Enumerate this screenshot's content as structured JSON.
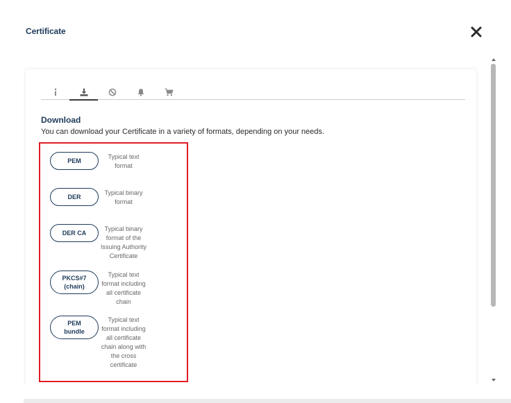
{
  "dialog": {
    "title": "Certificate",
    "close_icon": "close-icon"
  },
  "tabs": [
    {
      "icon": "info-icon",
      "active": false
    },
    {
      "icon": "download-icon",
      "active": true
    },
    {
      "icon": "revoke-icon",
      "active": false
    },
    {
      "icon": "bell-icon",
      "active": false
    },
    {
      "icon": "cart-icon",
      "active": false
    }
  ],
  "download": {
    "heading": "Download",
    "description": "You can download your Certificate in a variety of formats, depending on your needs.",
    "formats": [
      {
        "label_lines": [
          "PEM"
        ],
        "desc_lines": [
          "Typical text",
          "format"
        ]
      },
      {
        "label_lines": [
          "DER"
        ],
        "desc_lines": [
          "Typical binary",
          "format"
        ]
      },
      {
        "label_lines": [
          "DER CA"
        ],
        "desc_lines": [
          "Typical binary",
          "format of the",
          "Issuing Authority",
          "Certificate"
        ]
      },
      {
        "label_lines": [
          "PKCS#7",
          "(chain)"
        ],
        "desc_lines": [
          "Typical text",
          "format including",
          "all certificate",
          "chain"
        ]
      },
      {
        "label_lines": [
          "PEM",
          "bundle"
        ],
        "desc_lines": [
          "Typical text",
          "format including",
          "all certificate",
          "chain along with",
          "the cross",
          "certificate"
        ]
      }
    ]
  },
  "colors": {
    "highlight": "#e01b24",
    "accent": "#1d3a5a"
  }
}
